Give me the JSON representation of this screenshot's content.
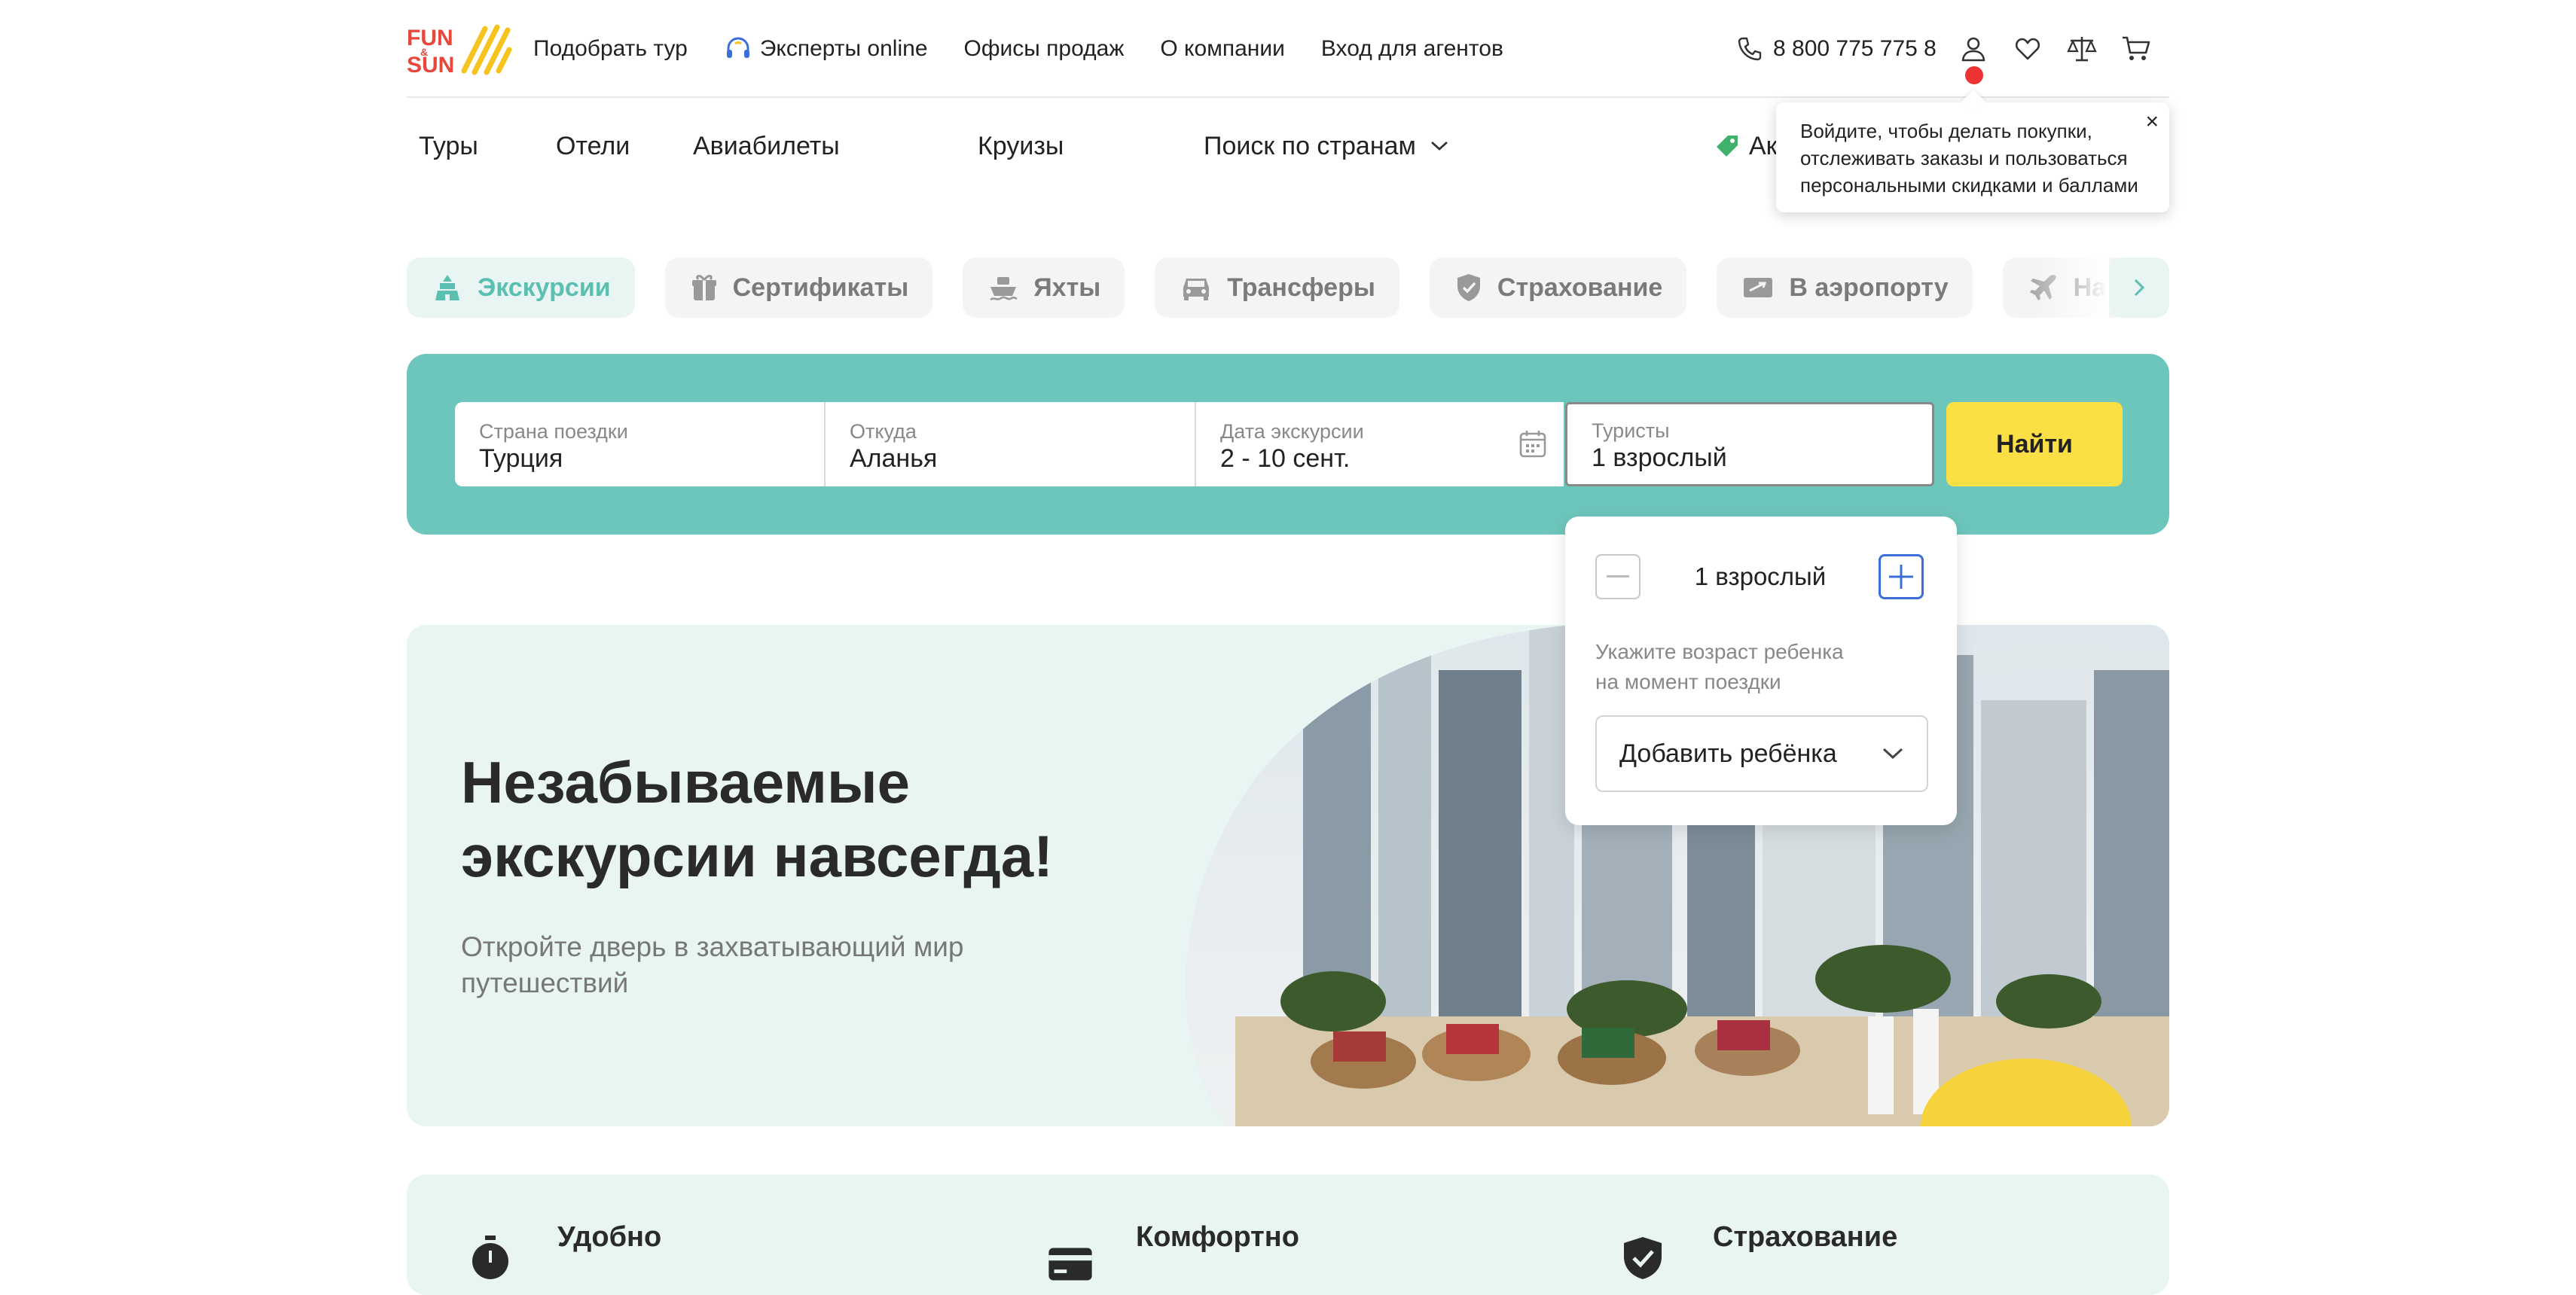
{
  "header": {
    "logo_text": "FUN & SUN",
    "top_links": [
      "Подобрать тур",
      "Эксперты online",
      "Офисы продаж",
      "О компании",
      "Вход для агентов"
    ],
    "phone": "8 800 775 775 8",
    "icons": [
      "phone-icon",
      "user-icon",
      "heart-icon",
      "compare-scales-icon",
      "cart-icon"
    ]
  },
  "main_nav": {
    "items": [
      "Туры",
      "Отели",
      "Авиабилеты",
      "Круизы",
      "Поиск по странам"
    ],
    "promo_label": "Ак"
  },
  "tooltip": {
    "line1": "Войдите, чтобы делать покупки,",
    "line2": "отслеживать заказы и пользоваться",
    "line3": "персональными скидками и баллами",
    "close": "×"
  },
  "categories": [
    {
      "label": "Экскурсии",
      "icon": "excursion-icon",
      "active": true
    },
    {
      "label": "Сертификаты",
      "icon": "gift-icon"
    },
    {
      "label": "Яхты",
      "icon": "yacht-icon"
    },
    {
      "label": "Трансферы",
      "icon": "car-icon"
    },
    {
      "label": "Страхование",
      "icon": "shield-icon"
    },
    {
      "label": "В аэропорту",
      "icon": "ticket-icon"
    },
    {
      "label": "На",
      "icon": "plane-icon"
    }
  ],
  "search": {
    "country_label": "Страна поездки",
    "country_value": "Турция",
    "from_label": "Откуда",
    "from_value": "Аланья",
    "date_label": "Дата экскурсии",
    "date_value": "2 - 10 сент.",
    "tourists_label": "Туристы",
    "tourists_value": "1 взрослый",
    "find_button": "Найти"
  },
  "tourists_dropdown": {
    "adults_value": "1 взрослый",
    "child_hint_line1": "Укажите возраст ребенка",
    "child_hint_line2": "на момент поездки",
    "add_child": "Добавить ребёнка"
  },
  "hero": {
    "title_line1": "Незабываемые",
    "title_line2": "экскурсии навсегда!",
    "subtitle_line1": "Откройте дверь в захватывающий мир",
    "subtitle_line2": "путешествий"
  },
  "features": [
    "Удобно",
    "Комфортно",
    "Страхование"
  ],
  "colors": {
    "accent_teal": "#6dc6bc",
    "light_teal": "#e8f5f3",
    "yellow": "#fbe045",
    "red_dot": "#e33333",
    "blue_plus": "#3b6ed8"
  }
}
